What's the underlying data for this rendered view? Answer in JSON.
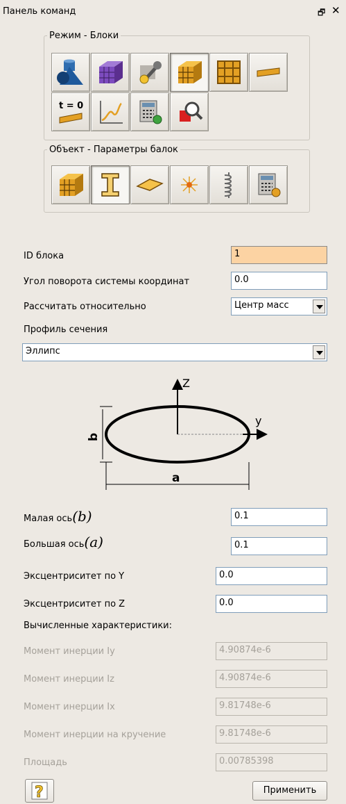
{
  "panel": {
    "title": "Панель команд"
  },
  "mode_group": {
    "legend": "Режим - Блоки",
    "buttons": [
      {
        "icon": "geometry-shapes-icon",
        "pressed": false
      },
      {
        "icon": "mesh-cube-purple-icon",
        "pressed": false
      },
      {
        "icon": "wrench-settings-icon",
        "pressed": false
      },
      {
        "icon": "blocks-cube-icon",
        "pressed": true
      },
      {
        "icon": "grid-frame-icon",
        "pressed": false
      },
      {
        "icon": "beam-profile-icon",
        "pressed": false
      },
      {
        "icon": "initial-condition-icon",
        "label": "t = 0",
        "pressed": false
      },
      {
        "icon": "curve-graph-icon",
        "pressed": false
      },
      {
        "icon": "calculator-gear-icon",
        "pressed": false
      },
      {
        "icon": "magnifier-inspect-icon",
        "pressed": false
      }
    ]
  },
  "object_group": {
    "legend": "Объект - Параметры балок",
    "buttons": [
      {
        "icon": "blocks-cube-icon",
        "pressed": false
      },
      {
        "icon": "i-beam-icon",
        "pressed": true
      },
      {
        "icon": "shell-diamond-icon",
        "pressed": false
      },
      {
        "icon": "point-spark-icon",
        "pressed": false
      },
      {
        "icon": "spring-coil-icon",
        "pressed": false
      },
      {
        "icon": "calculator-gear-icon",
        "pressed": false
      }
    ]
  },
  "form": {
    "block_id_label": "ID блока",
    "block_id_value": "1",
    "rotation_label": "Угол поворота системы координат",
    "rotation_value": "0.0",
    "relative_label": "Рассчитать относительно",
    "relative_value": "Центр масс",
    "profile_label": "Профиль сечения",
    "profile_value": "Эллипс",
    "minor_axis_label": "Малая ось",
    "minor_axis_math": "(b)",
    "minor_axis_value": "0.1",
    "major_axis_label": "Большая ось",
    "major_axis_math": "(a)",
    "major_axis_value": "0.1",
    "ecc_y_label": "Эксцентриситет по Y",
    "ecc_y_value": "0.0",
    "ecc_z_label": "Эксцентриситет по Z",
    "ecc_z_value": "0.0",
    "computed_label": "Вычисленные характеристики:",
    "iy_label": "Момент инерции Iy",
    "iy_value": "4.90874e-6",
    "iz_label": "Момент инерции Iz",
    "iz_value": "4.90874e-6",
    "ix_label": "Момент инерции Ix",
    "ix_value": "9.81748e-6",
    "torsion_label": "Момент инерции на кручение",
    "torsion_value": "9.81748e-6",
    "area_label": "Площадь",
    "area_value": "0.00785398"
  },
  "diagram": {
    "z_label": "Z",
    "y_label": "y",
    "a_label": "a",
    "b_label": "b"
  },
  "footer": {
    "apply_label": "Применить",
    "help_icon": "help-question-icon"
  },
  "colors": {
    "panel_bg": "#ede9e3",
    "highlight_field": "#fcd3a3",
    "disabled_text": "#a5a19a"
  }
}
